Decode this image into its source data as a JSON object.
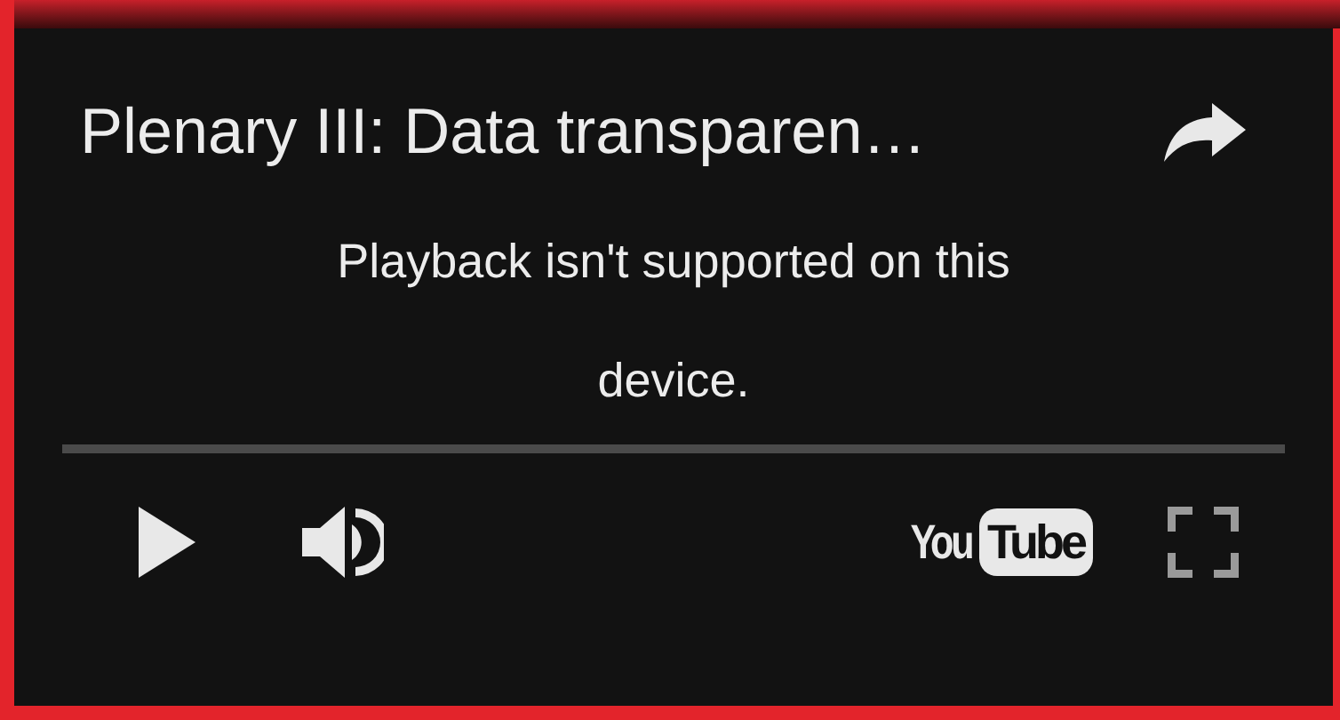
{
  "player": {
    "title": "Plenary III: Data transparen…",
    "message": "Playback isn't supported on this device.",
    "logo": {
      "left": "You",
      "right": "Tube"
    }
  }
}
